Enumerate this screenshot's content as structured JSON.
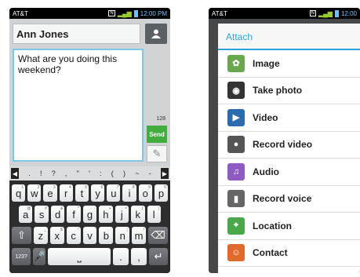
{
  "status": {
    "carrier": "AT&T",
    "time_left": "12:00 PM",
    "time_right": "12:00"
  },
  "message": {
    "recipient": "Ann Jones",
    "body": "What are you doing this weekend?",
    "char_counter": "128",
    "send_label": "Send"
  },
  "keyboard": {
    "symbols": [
      ".",
      "!",
      "?",
      ",",
      "\"",
      "'",
      ":",
      "(",
      ")",
      "~",
      "-"
    ],
    "row1": [
      [
        "q",
        "1"
      ],
      [
        "w",
        "2"
      ],
      [
        "e",
        "3"
      ],
      [
        "r",
        "4"
      ],
      [
        "t",
        "5"
      ],
      [
        "y",
        "6"
      ],
      [
        "u",
        "7"
      ],
      [
        "i",
        "8"
      ],
      [
        "o",
        "9"
      ],
      [
        "p",
        "0"
      ]
    ],
    "row2": [
      [
        "a",
        "@"
      ],
      [
        "s",
        "#"
      ],
      [
        "d",
        "&"
      ],
      [
        "f",
        "*"
      ],
      [
        "g",
        "-"
      ],
      [
        "h",
        "+"
      ],
      [
        "j",
        "="
      ],
      [
        "k",
        "("
      ],
      [
        "l",
        ")"
      ]
    ],
    "row3": [
      [
        "z",
        "_"
      ],
      [
        "x",
        "$"
      ],
      [
        "c",
        "\""
      ],
      [
        "v",
        "'"
      ],
      [
        "b",
        ":"
      ],
      [
        "n",
        ";"
      ],
      [
        "m",
        "/"
      ]
    ],
    "mode_key": "123?",
    "mode_key_sup": "☺"
  },
  "attach": {
    "title": "Attach",
    "items": [
      {
        "label": "Image",
        "icon": "image-icon",
        "color": "#6aa84f"
      },
      {
        "label": "Take photo",
        "icon": "camera-icon",
        "color": "#333333"
      },
      {
        "label": "Video",
        "icon": "video-icon",
        "color": "#2b6cb0"
      },
      {
        "label": "Record video",
        "icon": "record-video-icon",
        "color": "#555555"
      },
      {
        "label": "Audio",
        "icon": "audio-icon",
        "color": "#8e5bc4"
      },
      {
        "label": "Record voice",
        "icon": "microphone-icon",
        "color": "#666666"
      },
      {
        "label": "Location",
        "icon": "location-icon",
        "color": "#4aa84a"
      },
      {
        "label": "Contact",
        "icon": "contact-icon",
        "color": "#e06a2b"
      }
    ]
  }
}
